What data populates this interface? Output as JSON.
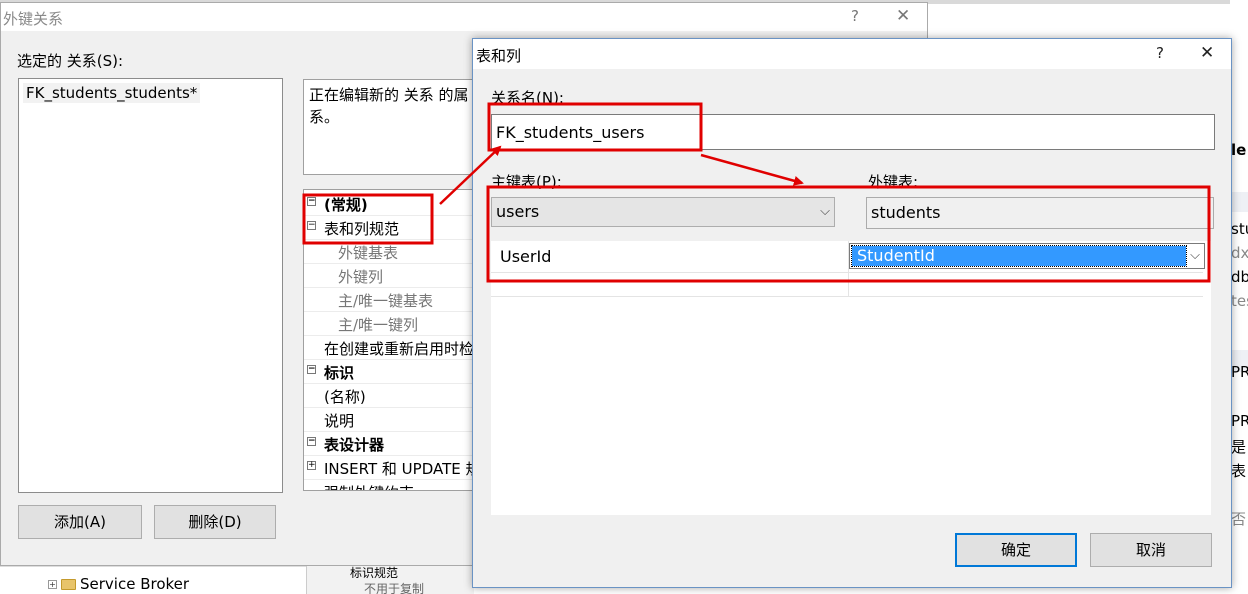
{
  "background": {
    "tree_item": "Service Broker",
    "mid_texts": [
      "标识规范",
      "不用于复制"
    ],
    "right_texts": [
      "le",
      "stu",
      "dx",
      "db",
      "tes",
      "PR",
      "PR",
      "是",
      "表",
      "否"
    ]
  },
  "fk_dialog": {
    "title": "外键关系",
    "help": "?",
    "close": "✕",
    "selected_label": "选定的 关系(S):",
    "relations": [
      "FK_students_students*"
    ],
    "description_lines": [
      "正在编辑新的 关系 的属",
      "系。"
    ],
    "properties": [
      {
        "kind": "cat",
        "toggle": "⊟",
        "label": "(常规)"
      },
      {
        "kind": "normal",
        "toggle": "⊟",
        "label": "表和列规范"
      },
      {
        "kind": "sub",
        "toggle": "",
        "label": "外键基表"
      },
      {
        "kind": "sub",
        "toggle": "",
        "label": "外键列"
      },
      {
        "kind": "sub",
        "toggle": "",
        "label": "主/唯一键基表"
      },
      {
        "kind": "sub",
        "toggle": "",
        "label": "主/唯一键列"
      },
      {
        "kind": "normal",
        "toggle": "",
        "label": "在创建或重新启用时检"
      },
      {
        "kind": "cat",
        "toggle": "⊟",
        "label": "标识"
      },
      {
        "kind": "normal",
        "toggle": "",
        "label": "(名称)"
      },
      {
        "kind": "normal",
        "toggle": "",
        "label": "说明"
      },
      {
        "kind": "cat",
        "toggle": "⊟",
        "label": "表设计器"
      },
      {
        "kind": "normal",
        "toggle": "⊞",
        "label": "INSERT 和 UPDATE 规"
      },
      {
        "kind": "normal",
        "toggle": "",
        "label": "强制外键约束"
      }
    ],
    "add_button": "添加(A)",
    "delete_button": "删除(D)"
  },
  "tc_dialog": {
    "title": "表和列",
    "help": "?",
    "close": "✕",
    "relation_name_label": "关系名(N):",
    "relation_name_value": "FK_students_users",
    "primary_table_label": "主键表(P):",
    "primary_table_value": "users",
    "foreign_table_label": "外键表:",
    "foreign_table_value": "students",
    "columns": [
      {
        "primary": "UserId",
        "foreign": "StudentId"
      }
    ],
    "ok_button": "确定",
    "cancel_button": "取消"
  },
  "colors": {
    "annotation_red": "#e00000",
    "selection_blue": "#3399ff",
    "dialog_bg": "#f0f0f0"
  }
}
